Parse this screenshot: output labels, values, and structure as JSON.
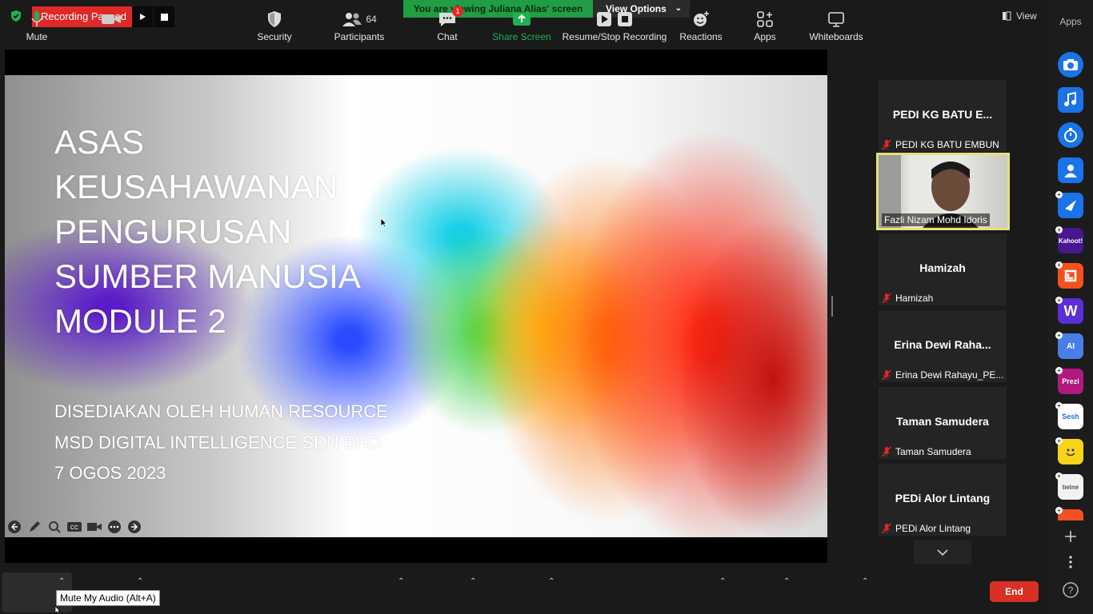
{
  "topbar": {
    "recording_status": "Recording Paused",
    "viewing_banner": "You are viewing Juliana Alias' screen",
    "view_options": "View Options",
    "view_label": "View"
  },
  "slide": {
    "title_lines": [
      "ASAS",
      "KEUSAHAWANAN",
      "PENGURUSAN",
      "SUMBER MANUSIA",
      "MODULE 2"
    ],
    "sub_lines": [
      "DISEDIAKAN OLEH HUMAN RESOURCE",
      "MSD DIGITAL INTELLIGENCE SDN BHD",
      "7 OGOS 2023"
    ]
  },
  "participants": [
    {
      "display": "PEDI KG BATU E...",
      "label": "PEDI KG BATU EMBUN"
    },
    {
      "display": "",
      "label": "Fazli Nizam Mohd Idoris"
    },
    {
      "display": "Hamizah",
      "label": "Hamizah"
    },
    {
      "display": "Erina  Dewi  Raha...",
      "label": "Erina Dewi Rahayu_PE..."
    },
    {
      "display": "Taman Samudera",
      "label": "Taman Samudera"
    },
    {
      "display": "PEDi Alor Lintang",
      "label": "PEDi Alor Lintang"
    }
  ],
  "apps_sidebar": {
    "title": "Apps",
    "apps": [
      {
        "name": "camera-app",
        "text": ""
      },
      {
        "name": "music-app",
        "text": ""
      },
      {
        "name": "timer-app",
        "text": ""
      },
      {
        "name": "profile-app",
        "text": ""
      },
      {
        "name": "play-app",
        "text": ""
      },
      {
        "name": "kahoot-app",
        "text": "Kahoot!"
      },
      {
        "name": "orange-app",
        "text": ""
      },
      {
        "name": "wordwall-app",
        "text": "W"
      },
      {
        "name": "ai-app",
        "text": "AI"
      },
      {
        "name": "prezi-app",
        "text": "Prezi"
      },
      {
        "name": "sesh-app",
        "text": "Sesh"
      },
      {
        "name": "smile-app",
        "text": ""
      },
      {
        "name": "twine-app",
        "text": "twine"
      }
    ]
  },
  "toolbar": {
    "mute": "Mute",
    "mute_tooltip": "Mute My Audio (Alt+A)",
    "security": "Security",
    "participants": "Participants",
    "participants_count": "64",
    "chat": "Chat",
    "chat_badge": "1",
    "share_screen": "Share Screen",
    "recording": "Resume/Stop Recording",
    "reactions": "Reactions",
    "apps": "Apps",
    "whiteboards": "Whiteboards",
    "end": "End"
  },
  "colors": {
    "recording_red": "#e02828",
    "viewing_green": "#1f9e45",
    "active_speaker_border": "#e5e17a",
    "end_red": "#d93025",
    "share_green": "#1fb052"
  }
}
